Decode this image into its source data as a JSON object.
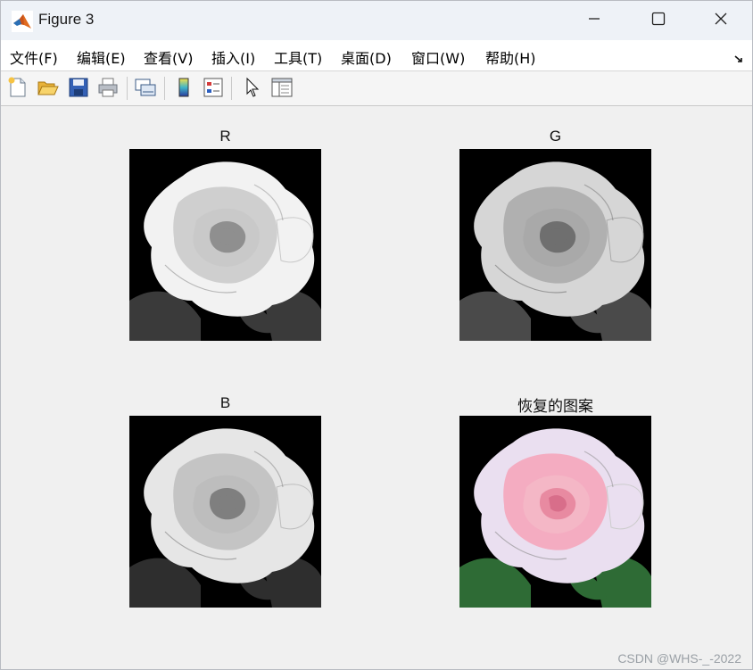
{
  "window": {
    "title": "Figure 3",
    "controls": {
      "minimize": "minimize",
      "maximize": "maximize",
      "close": "close"
    }
  },
  "menu": {
    "items": [
      {
        "label": "文件(F)"
      },
      {
        "label": "编辑(E)"
      },
      {
        "label": "查看(V)"
      },
      {
        "label": "插入(I)"
      },
      {
        "label": "工具(T)"
      },
      {
        "label": "桌面(D)"
      },
      {
        "label": "窗口(W)"
      },
      {
        "label": "帮助(H)"
      }
    ]
  },
  "toolbar": {
    "buttons": [
      {
        "icon": "new-figure-icon"
      },
      {
        "icon": "open-file-icon"
      },
      {
        "icon": "save-icon"
      },
      {
        "icon": "print-icon"
      },
      {
        "icon": "link-plot-icon"
      },
      {
        "icon": "colorbar-icon"
      },
      {
        "icon": "legend-icon"
      },
      {
        "icon": "edit-plot-pointer-icon"
      },
      {
        "icon": "property-inspector-icon"
      }
    ]
  },
  "axes": [
    {
      "title": "R",
      "channel": "red",
      "tint": "#ffffff"
    },
    {
      "title": "G",
      "channel": "green",
      "tint": "#ffffff"
    },
    {
      "title": "B",
      "channel": "blue",
      "tint": "#ffffff"
    },
    {
      "title": "恢复的图案",
      "channel": "rgb",
      "tint": "#f6a3b8"
    }
  ],
  "watermark": "CSDN @WHS-_-2022",
  "colors": {
    "titlebar": "#eef2f7",
    "menubar": "#ffffff",
    "canvas": "#f0f0f0",
    "image_background": "#000000",
    "petal_pink": "#f6a3b8",
    "leaf_green": "#2e6b35"
  }
}
